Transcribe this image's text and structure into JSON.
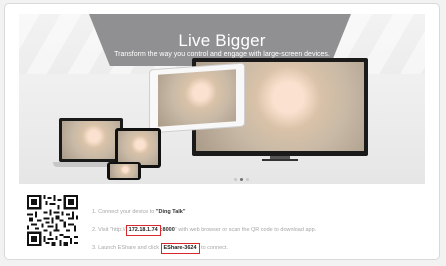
{
  "hero": {
    "title": "Live Bigger",
    "subtitle": "Transform the way you control and engage with large-screen devices."
  },
  "carousel": {
    "count": 3,
    "active": 2
  },
  "steps": [
    {
      "prefix": "1. Connect your device to ",
      "highlight": "\"Ding Talk\"",
      "suffix": ""
    },
    {
      "prefix": "2. Visit \"http://",
      "highlight": "172.18.1.74",
      "middle": ":8000",
      "suffix": "\" with web browser or scan the QR code to download app."
    },
    {
      "prefix": "3. Launch EShare and click ",
      "highlight": "EShare-3624",
      "suffix": " to connect."
    }
  ],
  "colors": {
    "highlight_border": "#d8272d",
    "banner": "#909092"
  },
  "icons": {
    "qr": "qr-code"
  }
}
